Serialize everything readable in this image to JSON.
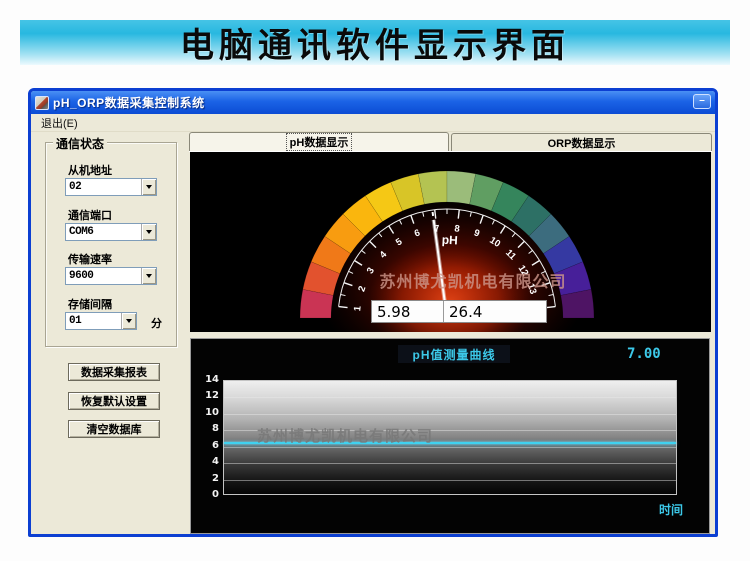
{
  "banner": {
    "title": "电脑通讯软件显示界面"
  },
  "window": {
    "title": "pH_ORP数据采集控制系统",
    "control_button_glyph": "–",
    "menu": {
      "exit": "退出(E)"
    }
  },
  "sidebar": {
    "group_title": "通信状态",
    "fields": [
      {
        "label": "从机地址",
        "value": "02"
      },
      {
        "label": "通信端口",
        "value": "COM6"
      },
      {
        "label": "传输速率",
        "value": "9600"
      },
      {
        "label": "存储间隔",
        "value": "01",
        "suffix": "分"
      }
    ],
    "buttons": [
      {
        "label": "数据采集报表"
      },
      {
        "label": "恢复默认设置"
      },
      {
        "label": "清空数据库"
      }
    ]
  },
  "tabs": [
    {
      "label": "pH数据显示",
      "active": true
    },
    {
      "label": "ORP数据显示",
      "active": false
    }
  ],
  "gauge": {
    "unit_label": "pH",
    "ph_value": "5.98",
    "temp_value": "26.4",
    "needle_value": 6.9,
    "scale_min": 1,
    "scale_max": 14,
    "segment_colors": [
      "#ca3454",
      "#e2522e",
      "#f07918",
      "#f89c10",
      "#fab60d",
      "#f5c815",
      "#d8c527",
      "#b4c352",
      "#9bbc7a",
      "#609e62",
      "#35855c",
      "#2d7065",
      "#3c6c7e",
      "#3539a2",
      "#471f99",
      "#4e1464"
    ],
    "watermark": "苏州博尤凯机电有限公司"
  },
  "chart_data": {
    "type": "line",
    "title": "pH值测量曲线",
    "current_value": "7.00",
    "xlabel": "时间",
    "ylim": [
      0,
      14
    ],
    "yticks": [
      14,
      12,
      10,
      8,
      6,
      4,
      2,
      0
    ],
    "gridlines": [
      12,
      10,
      8,
      6,
      4,
      2
    ],
    "grid": true,
    "legend_position": "none",
    "series": [
      {
        "name": "pH",
        "shape": "constant",
        "value": 6.4
      }
    ],
    "line_color": "#3fd2f0",
    "watermark": "苏州博尤凯机电有限公司"
  },
  "colors": {
    "banner_cyan": "#28b8e0",
    "titlebar_blue": "#1b63e6",
    "window_border": "#0c3fd2",
    "client_beige": "#ece9d8",
    "panel_black": "#000000",
    "accent_cyan": "#3cc8e8",
    "glow_red": "#c42a00"
  }
}
